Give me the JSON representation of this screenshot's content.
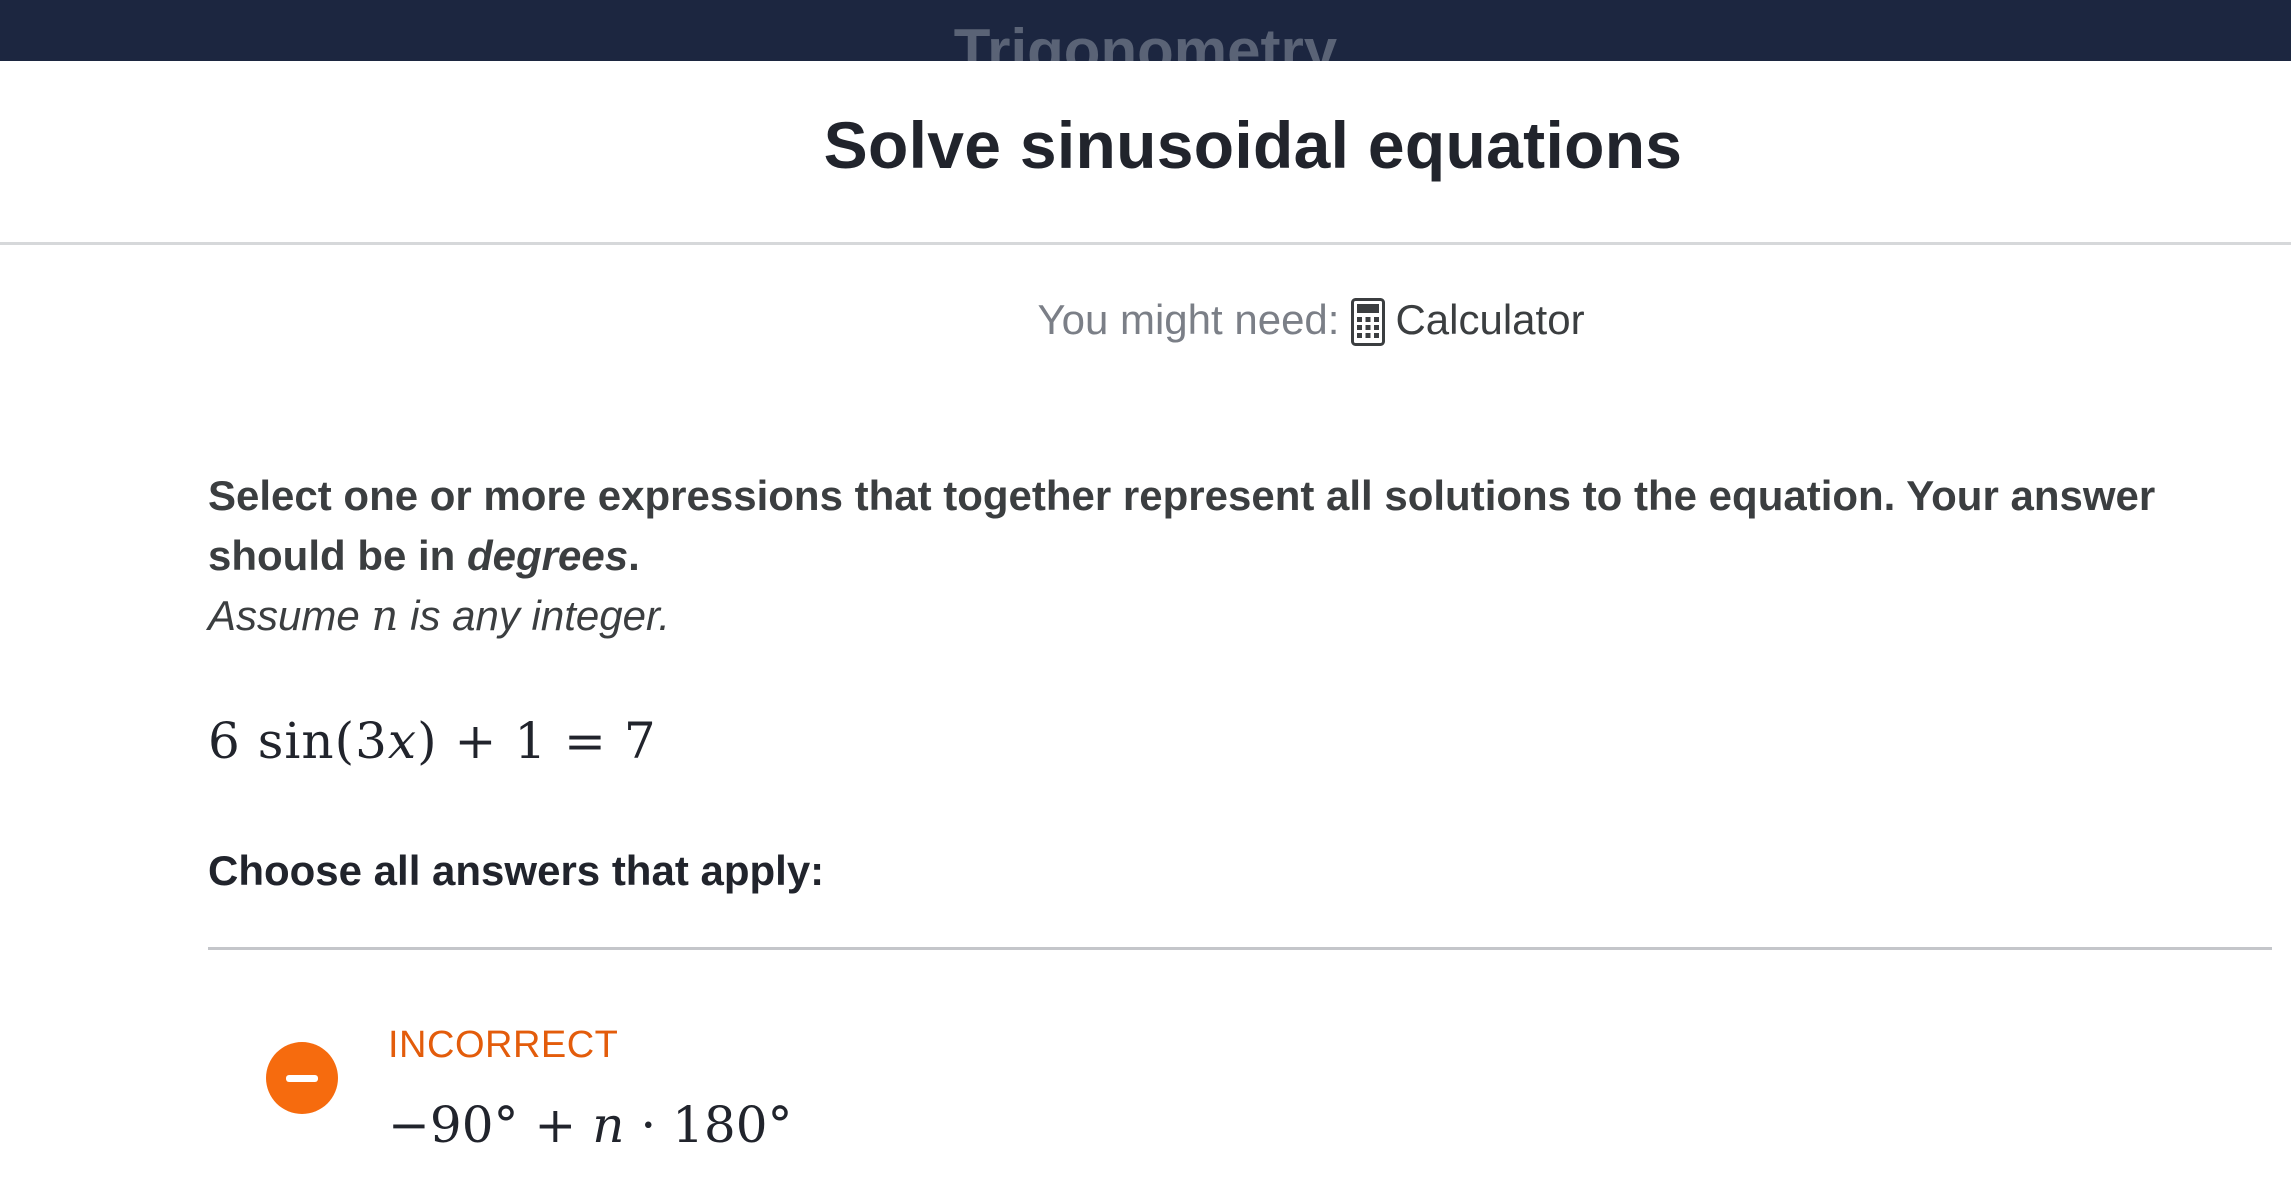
{
  "header": {
    "course_title": "Trigonometry",
    "exercise_title": "Solve sinusoidal equations"
  },
  "resources": {
    "label": "You might need:",
    "tool_icon": "calculator-icon",
    "tool_name": "Calculator"
  },
  "question": {
    "prompt_main": "Select one or more expressions that together represent all solutions to the equation. Your answer should be in",
    "prompt_unit": "degrees",
    "prompt_end": ".",
    "assume_prefix": "Assume",
    "assume_var": "n",
    "assume_suffix": "is any integer.",
    "equation": {
      "coef": "6",
      "func": "sin",
      "open": "(",
      "arg_num": "3",
      "arg_var": "x",
      "close": ")",
      "rest": "+ 1 = 7"
    },
    "choose_label": "Choose all answers that apply:"
  },
  "choices": [
    {
      "status": "INCORRECT",
      "status_color": "#e35c0b",
      "marker_color": "#f66b0e",
      "marker_icon": "minus-icon",
      "expr_lead": "−90° +",
      "expr_var": "n",
      "expr_tail": "· 180°"
    }
  ]
}
